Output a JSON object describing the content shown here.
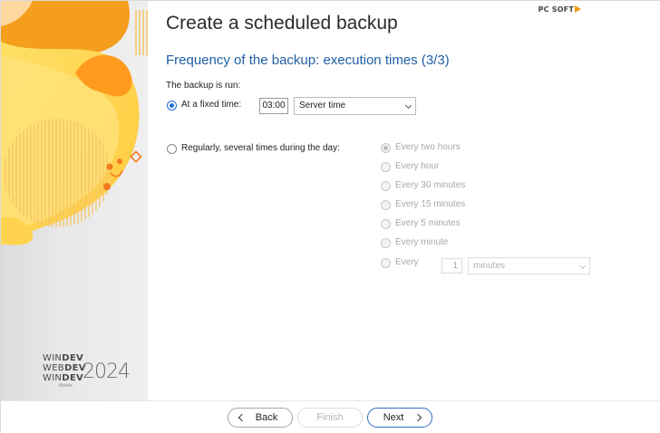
{
  "window": {
    "title": "Create a scheduled backup",
    "vendor": "PC SOFT"
  },
  "branding": {
    "lines": [
      "WINDEV",
      "WEBDEV",
      "WINDEV"
    ],
    "year": "2024",
    "mobile": "Mobile",
    "accent_color": "#f7941d"
  },
  "step": {
    "subtitle": "Frequency of the backup: execution times (3/3)",
    "run_label": "The backup is run:"
  },
  "fixed_time": {
    "label": "At a fixed time:",
    "selected": true,
    "time_value": "03:00",
    "timezone_select": "Server time"
  },
  "regular": {
    "label": "Regularly, several times during the day:",
    "selected": false,
    "options": [
      {
        "label": "Every two hours",
        "checked": true
      },
      {
        "label": "Every hour",
        "checked": false
      },
      {
        "label": "Every 30 minutes",
        "checked": false
      },
      {
        "label": "Every 15 minutes",
        "checked": false
      },
      {
        "label": "Every 5 minutes",
        "checked": false
      },
      {
        "label": "Every minute",
        "checked": false
      },
      {
        "label": "Every",
        "checked": false
      }
    ],
    "custom_value": "1",
    "custom_unit": "minutes"
  },
  "footer": {
    "back_label": "Back",
    "finish_label": "Finish",
    "next_label": "Next"
  }
}
